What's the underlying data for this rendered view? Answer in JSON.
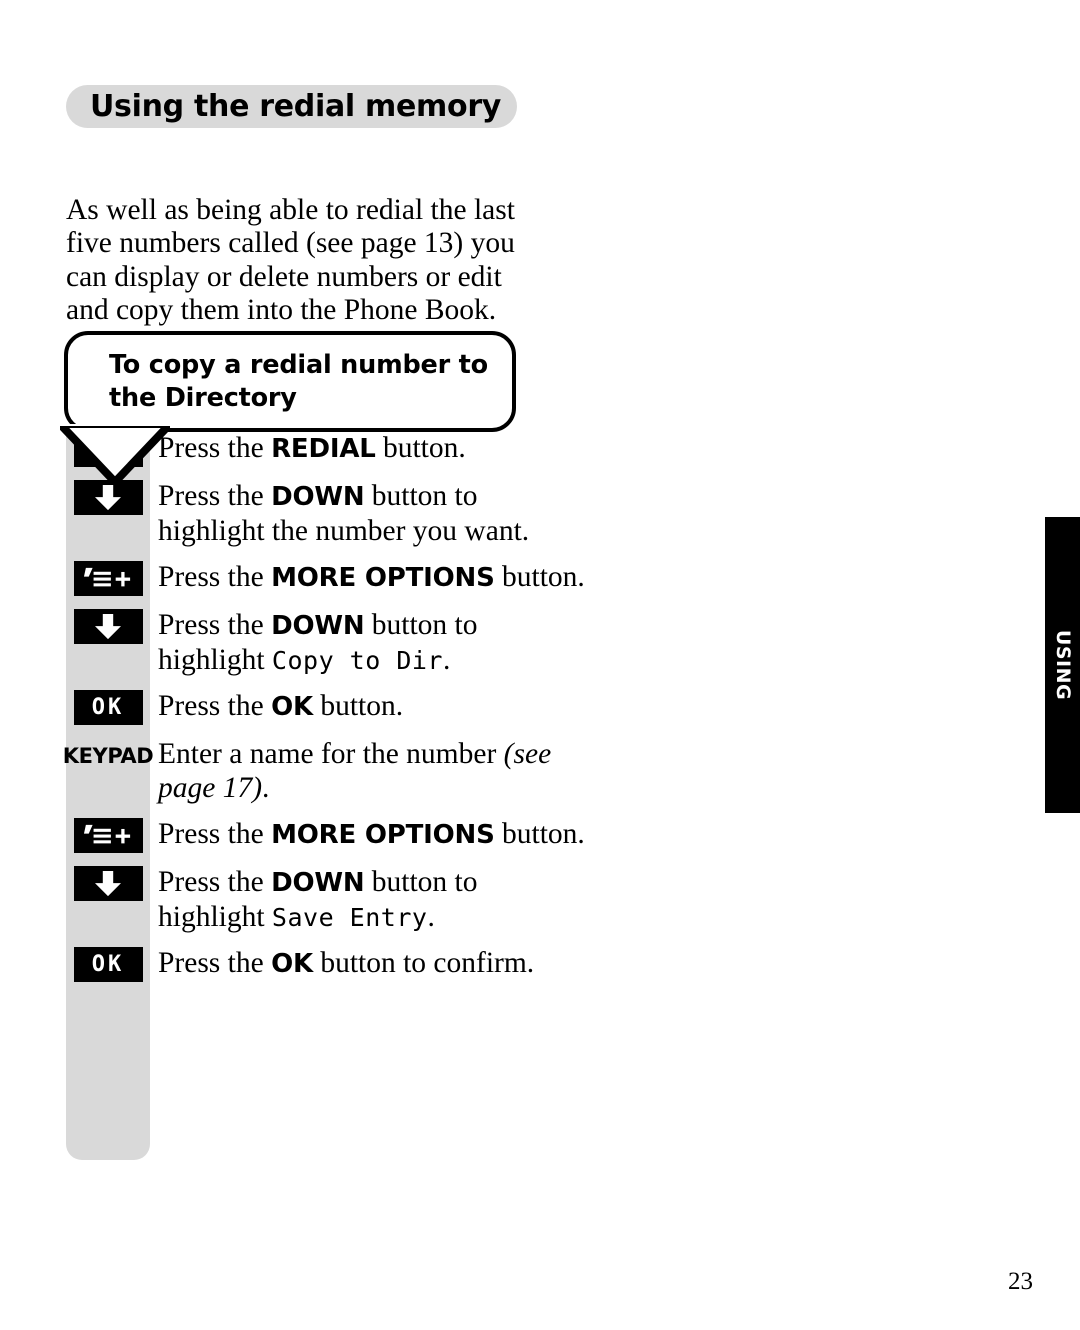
{
  "page": {
    "heading": "Using the redial memory",
    "page_number": "23",
    "side_tab_label": "USING"
  },
  "intro": {
    "paragraph": "As well as being able to redial the last five numbers called (see page 13) you can display or delete numbers or edit and copy them into the Phone Book."
  },
  "callout": {
    "title": "To copy a redial number to the Directory"
  },
  "steps": [
    {
      "icon": "redial-double-arrow-icon",
      "icon_type": "glyph",
      "icon_label": "",
      "text_parts": [
        {
          "kind": "plain",
          "text": "Press the "
        },
        {
          "kind": "button",
          "text": "REDIAL"
        },
        {
          "kind": "plain",
          "text": " button."
        }
      ]
    },
    {
      "icon": "down-arrow-icon",
      "icon_type": "glyph",
      "icon_label": "",
      "text_parts": [
        {
          "kind": "plain",
          "text": "Press the "
        },
        {
          "kind": "button",
          "text": "DOWN"
        },
        {
          "kind": "plain",
          "text": " button to highlight the number you want."
        }
      ]
    },
    {
      "icon": "more-options-icon",
      "icon_type": "glyph",
      "icon_label": "",
      "text_parts": [
        {
          "kind": "plain",
          "text": "Press the "
        },
        {
          "kind": "button",
          "text": "MORE OPTIONS"
        },
        {
          "kind": "plain",
          "text": " button."
        }
      ]
    },
    {
      "icon": "down-arrow-icon",
      "icon_type": "glyph",
      "icon_label": "",
      "text_parts": [
        {
          "kind": "plain",
          "text": "Press the "
        },
        {
          "kind": "button",
          "text": "DOWN"
        },
        {
          "kind": "plain",
          "text": " button to highlight "
        },
        {
          "kind": "lcd",
          "text": "Copy to Dir"
        },
        {
          "kind": "plain",
          "text": "."
        }
      ]
    },
    {
      "icon": "ok-button-icon",
      "icon_type": "lcd",
      "icon_label": "OK",
      "text_parts": [
        {
          "kind": "plain",
          "text": "Press the "
        },
        {
          "kind": "button",
          "text": "OK"
        },
        {
          "kind": "plain",
          "text": " button."
        }
      ]
    },
    {
      "icon": "keypad-icon",
      "icon_type": "keypad",
      "icon_label": "KEYPAD",
      "text_parts": [
        {
          "kind": "plain",
          "text": "Enter a name for the number "
        },
        {
          "kind": "italic",
          "text": "(see page 17)"
        },
        {
          "kind": "plain",
          "text": "."
        }
      ]
    },
    {
      "icon": "more-options-icon",
      "icon_type": "glyph",
      "icon_label": "",
      "text_parts": [
        {
          "kind": "plain",
          "text": "Press the "
        },
        {
          "kind": "button",
          "text": "MORE OPTIONS"
        },
        {
          "kind": "plain",
          "text": " button."
        }
      ]
    },
    {
      "icon": "down-arrow-icon",
      "icon_type": "glyph",
      "icon_label": "",
      "text_parts": [
        {
          "kind": "plain",
          "text": "Press the "
        },
        {
          "kind": "button",
          "text": "DOWN"
        },
        {
          "kind": "plain",
          "text": " button to highlight "
        },
        {
          "kind": "lcd",
          "text": "Save Entry"
        },
        {
          "kind": "plain",
          "text": "."
        }
      ]
    },
    {
      "icon": "ok-button-icon",
      "icon_type": "lcd",
      "icon_label": "OK",
      "text_parts": [
        {
          "kind": "plain",
          "text": "Press the "
        },
        {
          "kind": "button",
          "text": "OK"
        },
        {
          "kind": "plain",
          "text": " button to confirm."
        }
      ]
    }
  ],
  "colors": {
    "heading_pill_bg": "#d9d9d9",
    "steps_column_bg": "#d9d9d9",
    "chip_bg": "#000000",
    "side_tab_bg": "#000000"
  }
}
